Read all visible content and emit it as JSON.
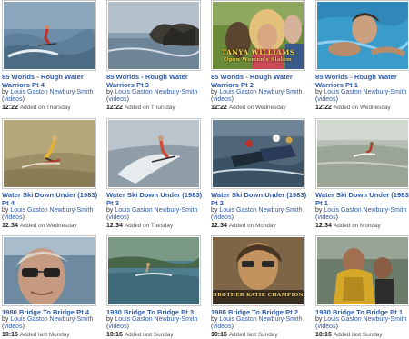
{
  "videos": [
    {
      "title": "85 Worlds - Rough Water Warriors Pt 4",
      "by": "by",
      "author": "Louis Gaston Newbury-Smith",
      "category": "videos",
      "duration": "12:22",
      "added": "Added on Thursday",
      "thumb": "ski-wave"
    },
    {
      "title": "85 Worlds - Rough Water Warriors Pt 3",
      "by": "by",
      "author": "Louis Gaston Newbury-Smith",
      "category": "videos",
      "duration": "12:22",
      "added": "Added on Thursday",
      "thumb": "rocky-shore"
    },
    {
      "title": "85 Worlds - Rough Water Warriors Pt 2",
      "by": "by",
      "author": "Louis Gaston Newbury-Smith",
      "category": "videos",
      "duration": "12:22",
      "added": "Added on Wednesday",
      "thumb": "blonde-woman",
      "caption": "TANYA WILLIAMS",
      "caption2": "Open Women's Slalom"
    },
    {
      "title": "85 Worlds - Rough Water Warriors Pt 1",
      "by": "by",
      "author": "Louis Gaston Newbury-Smith",
      "category": "videos",
      "duration": "12:22",
      "added": "Added on Wednesday",
      "thumb": "swimmer"
    },
    {
      "title": "Water Ski Down Under (1983) Pt 4",
      "by": "by",
      "author": "Louis Gaston Newbury-Smith",
      "category": "videos",
      "duration": "12:34",
      "added": "Added on Wednesday",
      "thumb": "ski-brown"
    },
    {
      "title": "Water Ski Down Under (1983) Pt 3",
      "by": "by",
      "author": "Louis Gaston Newbury-Smith",
      "category": "videos",
      "duration": "12:34",
      "added": "Added on Tuesday",
      "thumb": "ski-spray"
    },
    {
      "title": "Water Ski Down Under (1983) Pt 2",
      "by": "by",
      "author": "Louis Gaston Newbury-Smith",
      "category": "videos",
      "duration": "12:34",
      "added": "Added on Monday",
      "thumb": "jetski"
    },
    {
      "title": "Water Ski Down Under (1983) Pt 1",
      "by": "by",
      "author": "Louis Gaston Newbury-Smith",
      "category": "videos",
      "duration": "12:34",
      "added": "Added on Monday",
      "thumb": "ski-distant"
    },
    {
      "title": "1980 Bridge To Bridge Pt 4",
      "by": "by",
      "author": "Louis Gaston Newbury-Smith",
      "category": "videos",
      "duration": "10:16",
      "added": "Added last Monday",
      "thumb": "man-glasses"
    },
    {
      "title": "1980 Bridge To Bridge Pt 3",
      "by": "by",
      "author": "Louis Gaston Newbury-Smith",
      "category": "videos",
      "duration": "10:16",
      "added": "Added last Sunday",
      "thumb": "river"
    },
    {
      "title": "1980 Bridge To Bridge Pt 2",
      "by": "by",
      "author": "Louis Gaston Newbury-Smith",
      "category": "videos",
      "duration": "10:16",
      "added": "Added last Sunday",
      "thumb": "woman-caption",
      "caption": "BROTHER KATIE  CHAMPION"
    },
    {
      "title": "1980 Bridge To Bridge Pt 1",
      "by": "by",
      "author": "Louis Gaston Newbury-Smith",
      "category": "videos",
      "duration": "10:16",
      "added": "Added last Sunday",
      "thumb": "lifejacket"
    }
  ],
  "colors": {
    "link": "#2f5aa8",
    "border": "#c9c9c9"
  }
}
